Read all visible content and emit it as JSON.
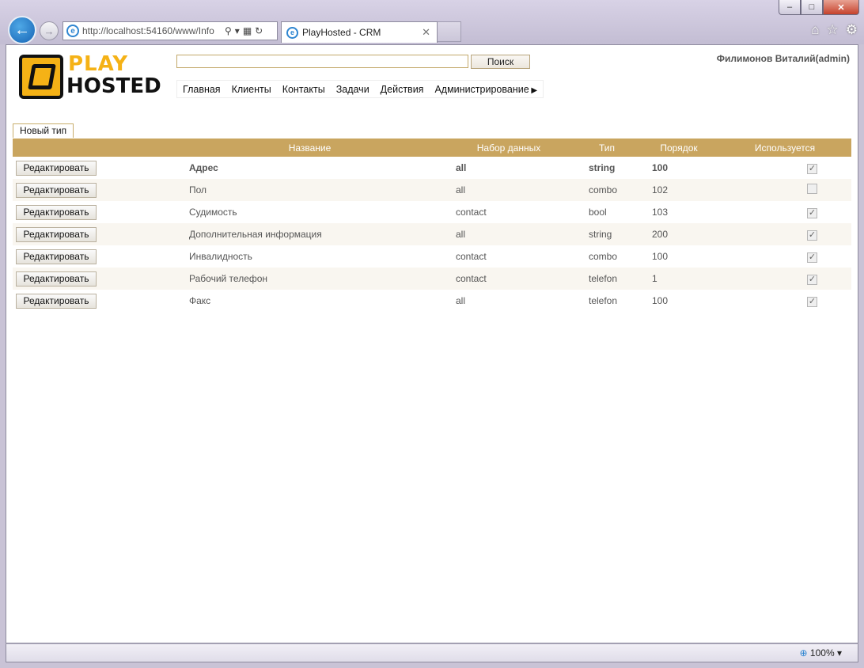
{
  "browser": {
    "address": "http://localhost:54160/www/Info",
    "address_host": "localhost",
    "tab_title": "PlayHosted - CRM",
    "zoom": "100%"
  },
  "header": {
    "logo_play": "PLAY",
    "logo_hosted": "HOSTED",
    "search_value": "",
    "search_button": "Поиск",
    "user": "Филимонов Виталий(admin)"
  },
  "menu": [
    "Главная",
    "Клиенты",
    "Контакты",
    "Задачи",
    "Действия",
    "Администрирование"
  ],
  "new_type_button": "Новый тип",
  "table": {
    "columns": [
      "",
      "Название",
      "Набор данных",
      "Тип",
      "Порядок",
      "Используется"
    ],
    "edit_label": "Редактировать",
    "rows": [
      {
        "name": "Адрес",
        "dataset": "all",
        "type": "string",
        "order": "100",
        "used": true
      },
      {
        "name": "Пол",
        "dataset": "all",
        "type": "combo",
        "order": "102",
        "used": false
      },
      {
        "name": "Судимость",
        "dataset": "contact",
        "type": "bool",
        "order": "103",
        "used": true
      },
      {
        "name": "Дополнительная информация",
        "dataset": "all",
        "type": "string",
        "order": "200",
        "used": true
      },
      {
        "name": "Инвалидность",
        "dataset": "contact",
        "type": "combo",
        "order": "100",
        "used": true
      },
      {
        "name": "Рабочий телефон",
        "dataset": "contact",
        "type": "telefon",
        "order": "1",
        "used": true
      },
      {
        "name": "Факс",
        "dataset": "all",
        "type": "telefon",
        "order": "100",
        "used": true
      }
    ]
  }
}
